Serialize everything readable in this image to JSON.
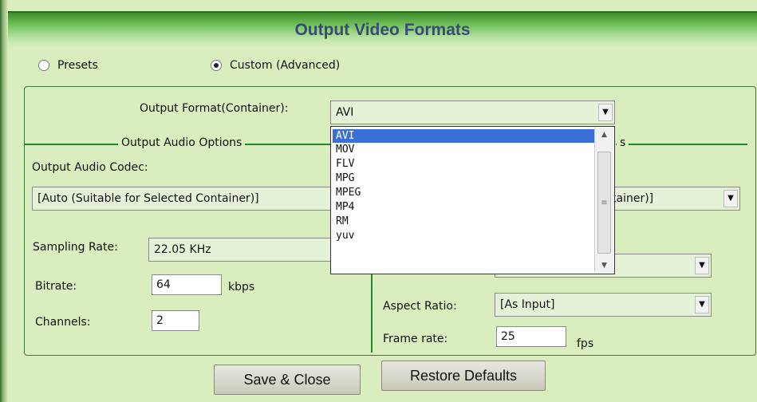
{
  "window": {
    "title": "Output Video Formats"
  },
  "mode": {
    "presets_label": "Presets",
    "custom_label": "Custom (Advanced)",
    "selected": "custom"
  },
  "output_format": {
    "label": "Output Format(Container):",
    "value": "AVI",
    "options": [
      "AVI",
      "MOV",
      "FLV",
      "MPG",
      "MPEG",
      "MP4",
      "RM",
      "yuv"
    ],
    "selected_index": 0
  },
  "audio": {
    "group_title": "Output Audio Options",
    "codec_label": "Output Audio Codec:",
    "codec_value": "[Auto (Suitable for Selected Container)]",
    "sampling_label": "Sampling Rate:",
    "sampling_value": "22.05 KHz",
    "bitrate_label": "Bitrate:",
    "bitrate_value": "64",
    "bitrate_unit": "kbps",
    "channels_label": "Channels:",
    "channels_value": "2"
  },
  "video": {
    "group_title_partial": "s",
    "codec_value_partial": "tainer)]",
    "size_value_partial": "[...]",
    "aspect_label": "Aspect Ratio:",
    "aspect_value": "[As Input]",
    "framerate_label": "Frame rate:",
    "framerate_value": "25",
    "framerate_unit": "fps"
  },
  "buttons": {
    "save": "Save & Close",
    "restore": "Restore Defaults"
  }
}
